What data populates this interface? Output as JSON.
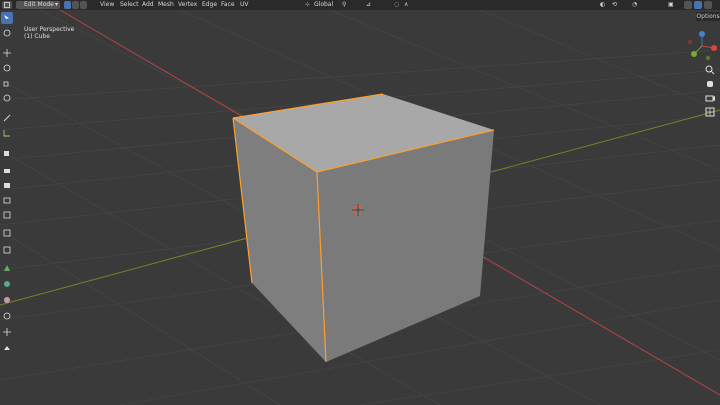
{
  "header": {
    "mode": "Edit Mode",
    "menus": [
      "View",
      "Select",
      "Add",
      "Mesh",
      "Vertex",
      "Edge",
      "Face",
      "UV"
    ],
    "transform_orientation": "Global",
    "axes": [
      "X",
      "Y",
      "Z"
    ],
    "options_label": "Options"
  },
  "viewport": {
    "view_name": "User Perspective",
    "object_name": "(1) Cube"
  },
  "gizmo": {
    "x": "X",
    "y": "Y",
    "z": "Z"
  },
  "colors": {
    "header_bg": "#2a2a2a",
    "viewport_bg": "#3a3a3a",
    "accent": "#4772b3",
    "edge_select": "#ff9f2a",
    "axis_x": "#b34448",
    "axis_y": "#6b8a2a"
  },
  "toolbar_icons": [
    "select-box-icon",
    "cursor-icon",
    "move-icon",
    "rotate-icon",
    "scale-icon",
    "transform-icon",
    "annotate-icon",
    "measure-icon",
    "add-cube-icon",
    "extrude-icon",
    "inset-icon",
    "bevel-icon",
    "loop-cut-icon",
    "knife-icon",
    "poly-build-icon",
    "spin-icon",
    "smooth-icon",
    "edge-slide-icon",
    "shrink-icon",
    "shear-icon",
    "rip-icon"
  ]
}
